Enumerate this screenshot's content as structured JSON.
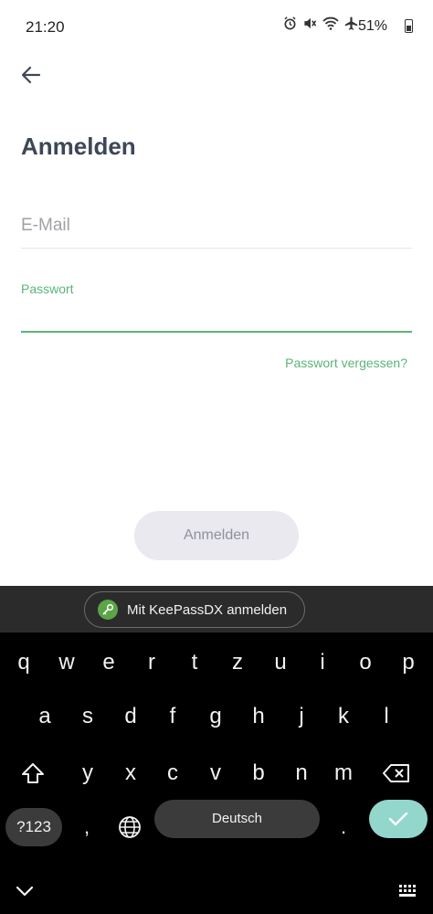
{
  "status": {
    "time": "21:20",
    "battery": "51%",
    "icons": [
      "alarm-icon",
      "mute-icon",
      "wifi-icon",
      "airplane-icon"
    ]
  },
  "header": {
    "back_icon": "arrow-left-icon",
    "title": "Anmelden"
  },
  "form": {
    "email_placeholder": "E-Mail",
    "email_value": "",
    "password_label": "Passwort",
    "password_value": "",
    "forgot_link": "Passwort vergessen?",
    "login_button": "Anmelden"
  },
  "autofill": {
    "label": "Mit KeePassDX anmelden",
    "icon": "keepassdx-icon"
  },
  "keyboard": {
    "row1": [
      "q",
      "w",
      "e",
      "r",
      "t",
      "z",
      "u",
      "i",
      "o",
      "p"
    ],
    "row2": [
      "a",
      "s",
      "d",
      "f",
      "g",
      "h",
      "j",
      "k",
      "l"
    ],
    "row3": [
      "y",
      "x",
      "c",
      "v",
      "b",
      "n",
      "m"
    ],
    "symbols_key": "?123",
    "comma_key": ",",
    "space_label": "Deutsch",
    "period_key": ".",
    "colors": {
      "enter_bg": "#93d6cc",
      "accent": "#5bb476"
    }
  }
}
